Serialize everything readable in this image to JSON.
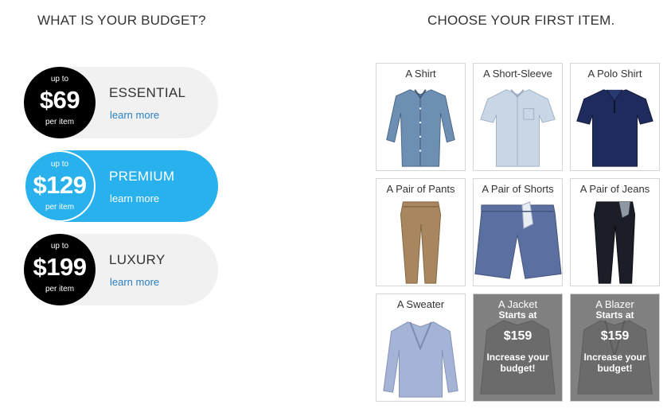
{
  "budget": {
    "heading": "WHAT IS YOUR BUDGET?",
    "tiers": [
      {
        "upto": "up to",
        "price": "$69",
        "per": "per item",
        "name": "ESSENTIAL",
        "link": "learn more"
      },
      {
        "upto": "up to",
        "price": "$129",
        "per": "per item",
        "name": "PREMIUM",
        "link": "learn more"
      },
      {
        "upto": "up to",
        "price": "$199",
        "per": "per item",
        "name": "LUXURY",
        "link": "learn more"
      }
    ],
    "selected": "PREMIUM"
  },
  "items": {
    "heading": "CHOOSE YOUR FIRST ITEM.",
    "list": [
      {
        "label": "A Shirt",
        "icon": "shirt-icon"
      },
      {
        "label": "A Short-Sleeve",
        "icon": "short-sleeve-shirt-icon"
      },
      {
        "label": "A Polo Shirt",
        "icon": "polo-shirt-icon"
      },
      {
        "label": "A Pair of Pants",
        "icon": "pants-icon"
      },
      {
        "label": "A Pair of Shorts",
        "icon": "shorts-icon"
      },
      {
        "label": "A Pair of Jeans",
        "icon": "jeans-icon"
      },
      {
        "label": "A Sweater",
        "icon": "sweater-icon"
      },
      {
        "label": "A Jacket",
        "icon": "jacket-icon",
        "starts": "Starts at",
        "price": "$159",
        "note": "Increase your budget!"
      },
      {
        "label": "A Blazer",
        "icon": "blazer-icon",
        "starts": "Starts at",
        "price": "$159",
        "note": "Increase your budget!"
      }
    ]
  },
  "colors": {
    "accent": "#29b1ee",
    "link": "#2a7fc1",
    "tier_bg": "#f1f1f1",
    "locked_overlay": "#808080"
  }
}
